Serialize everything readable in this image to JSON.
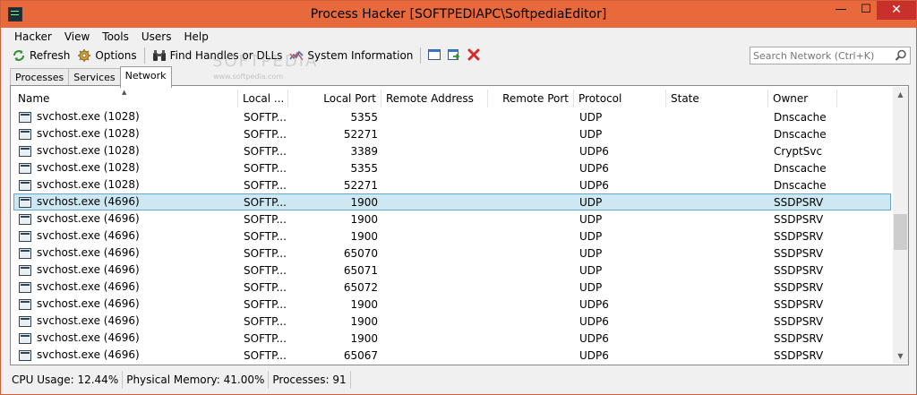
{
  "window": {
    "title": "Process Hacker [SOFTPEDIAPC\\SoftpediaEditor]",
    "controls": {
      "minimize": "—",
      "maximize": "☐",
      "close": "✕"
    }
  },
  "menu": [
    "Hacker",
    "View",
    "Tools",
    "Users",
    "Help"
  ],
  "toolbar": {
    "refresh_label": "Refresh",
    "options_label": "Options",
    "find_label": "Find Handles or DLLs",
    "sysinfo_label": "System Information"
  },
  "search": {
    "placeholder": "Search Network (Ctrl+K)"
  },
  "watermark": {
    "text": "SOFTPEDIA",
    "url": "www.softpedia.com"
  },
  "tabs": [
    {
      "label": "Processes"
    },
    {
      "label": "Services"
    },
    {
      "label": "Network"
    }
  ],
  "active_tab": "Network",
  "table": {
    "columns": [
      "Name",
      "Local ...",
      "Local Port",
      "Remote Address",
      "Remote Port",
      "Protocol",
      "State",
      "Owner"
    ],
    "rows": [
      {
        "name": "svchost.exe (1028)",
        "local_addr": "SOFTP...",
        "local_port": "5355",
        "remote_addr": "",
        "remote_port": "",
        "protocol": "UDP",
        "state": "",
        "owner": "Dnscache"
      },
      {
        "name": "svchost.exe (1028)",
        "local_addr": "SOFTP...",
        "local_port": "52271",
        "remote_addr": "",
        "remote_port": "",
        "protocol": "UDP",
        "state": "",
        "owner": "Dnscache"
      },
      {
        "name": "svchost.exe (1028)",
        "local_addr": "SOFTP...",
        "local_port": "3389",
        "remote_addr": "",
        "remote_port": "",
        "protocol": "UDP6",
        "state": "",
        "owner": "CryptSvc"
      },
      {
        "name": "svchost.exe (1028)",
        "local_addr": "SOFTP...",
        "local_port": "5355",
        "remote_addr": "",
        "remote_port": "",
        "protocol": "UDP6",
        "state": "",
        "owner": "Dnscache"
      },
      {
        "name": "svchost.exe (1028)",
        "local_addr": "SOFTP...",
        "local_port": "52271",
        "remote_addr": "",
        "remote_port": "",
        "protocol": "UDP6",
        "state": "",
        "owner": "Dnscache"
      },
      {
        "name": "svchost.exe (4696)",
        "local_addr": "SOFTP...",
        "local_port": "1900",
        "remote_addr": "",
        "remote_port": "",
        "protocol": "UDP",
        "state": "",
        "owner": "SSDPSRV",
        "selected": true
      },
      {
        "name": "svchost.exe (4696)",
        "local_addr": "SOFTP...",
        "local_port": "1900",
        "remote_addr": "",
        "remote_port": "",
        "protocol": "UDP",
        "state": "",
        "owner": "SSDPSRV"
      },
      {
        "name": "svchost.exe (4696)",
        "local_addr": "SOFTP...",
        "local_port": "1900",
        "remote_addr": "",
        "remote_port": "",
        "protocol": "UDP",
        "state": "",
        "owner": "SSDPSRV"
      },
      {
        "name": "svchost.exe (4696)",
        "local_addr": "SOFTP...",
        "local_port": "65070",
        "remote_addr": "",
        "remote_port": "",
        "protocol": "UDP",
        "state": "",
        "owner": "SSDPSRV"
      },
      {
        "name": "svchost.exe (4696)",
        "local_addr": "SOFTP...",
        "local_port": "65071",
        "remote_addr": "",
        "remote_port": "",
        "protocol": "UDP",
        "state": "",
        "owner": "SSDPSRV"
      },
      {
        "name": "svchost.exe (4696)",
        "local_addr": "SOFTP...",
        "local_port": "65072",
        "remote_addr": "",
        "remote_port": "",
        "protocol": "UDP",
        "state": "",
        "owner": "SSDPSRV"
      },
      {
        "name": "svchost.exe (4696)",
        "local_addr": "SOFTP...",
        "local_port": "1900",
        "remote_addr": "",
        "remote_port": "",
        "protocol": "UDP6",
        "state": "",
        "owner": "SSDPSRV"
      },
      {
        "name": "svchost.exe (4696)",
        "local_addr": "SOFTP...",
        "local_port": "1900",
        "remote_addr": "",
        "remote_port": "",
        "protocol": "UDP6",
        "state": "",
        "owner": "SSDPSRV"
      },
      {
        "name": "svchost.exe (4696)",
        "local_addr": "SOFTP...",
        "local_port": "1900",
        "remote_addr": "",
        "remote_port": "",
        "protocol": "UDP6",
        "state": "",
        "owner": "SSDPSRV"
      },
      {
        "name": "svchost.exe (4696)",
        "local_addr": "SOFTP...",
        "local_port": "65067",
        "remote_addr": "",
        "remote_port": "",
        "protocol": "UDP6",
        "state": "",
        "owner": "SSDPSRV"
      }
    ]
  },
  "status": {
    "cpu": "CPU Usage: 12.44%",
    "memory": "Physical Memory: 41.00%",
    "processes": "Processes: 91"
  },
  "colors": {
    "titlebar": "#e86a3c",
    "close_button": "#c7302b",
    "selection_bg": "#cde8f3",
    "selection_border": "#6aa6c7"
  },
  "icons": {
    "app": "process-hacker-icon",
    "refresh": "refresh-icon",
    "options": "gear-icon",
    "find": "binoculars-icon",
    "sysinfo": "chart-icon",
    "tb_window": "window-icon",
    "tb_go": "go-icon",
    "tb_close": "close-icon",
    "search": "search-icon",
    "process": "process-icon"
  }
}
